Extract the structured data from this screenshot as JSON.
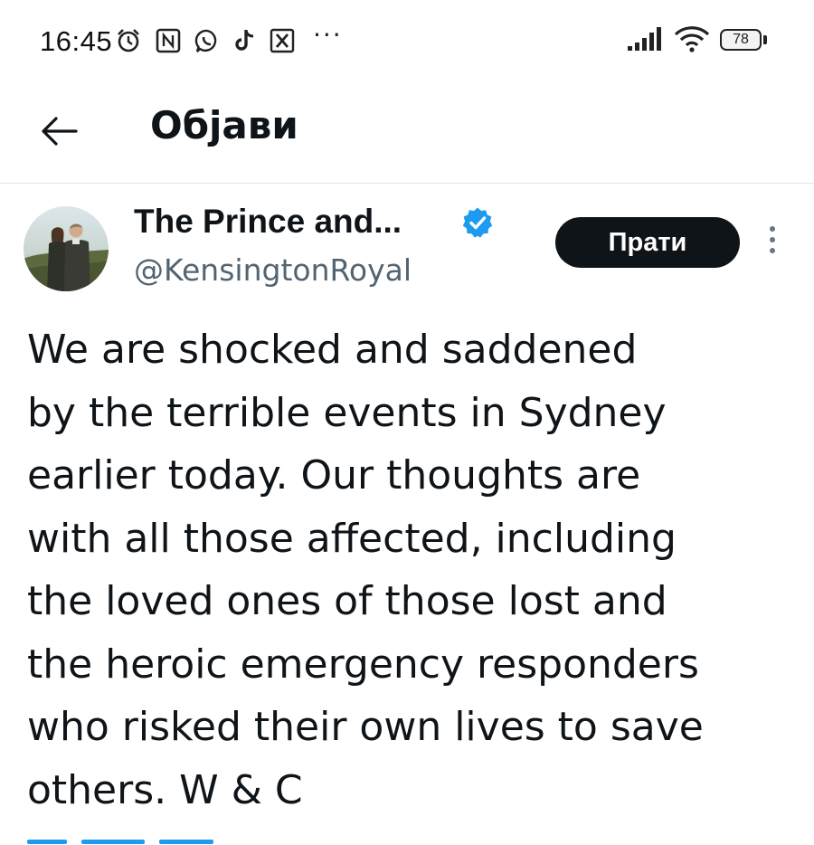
{
  "status_bar": {
    "time": "16:45",
    "more": "···",
    "battery": "78",
    "icons": [
      "alarm-icon",
      "nfc-icon",
      "whatsapp-icon",
      "tiktok-icon",
      "x-app-icon",
      "signal-icon",
      "wifi-icon",
      "battery-icon"
    ]
  },
  "header": {
    "back_icon": "arrow-left-icon",
    "title": "Објави"
  },
  "tweet": {
    "display_name": "The Prince and...",
    "verified": true,
    "handle": "@KensingtonRoyal",
    "follow_label": "Прати",
    "text_lines": [
      "We are shocked and saddened",
      "by the terrible events in Sydney",
      "earlier today. Our thoughts are",
      "with all those affected, including",
      "the loved ones of those lost and",
      "the heroic emergency responders",
      "who risked their own lives to save",
      "others. W & C"
    ]
  },
  "colors": {
    "text": "#0f1419",
    "secondary": "#536471",
    "verified_blue": "#1d9bf0",
    "follow_bg": "#0f1419",
    "divider": "#dfe3e6"
  }
}
